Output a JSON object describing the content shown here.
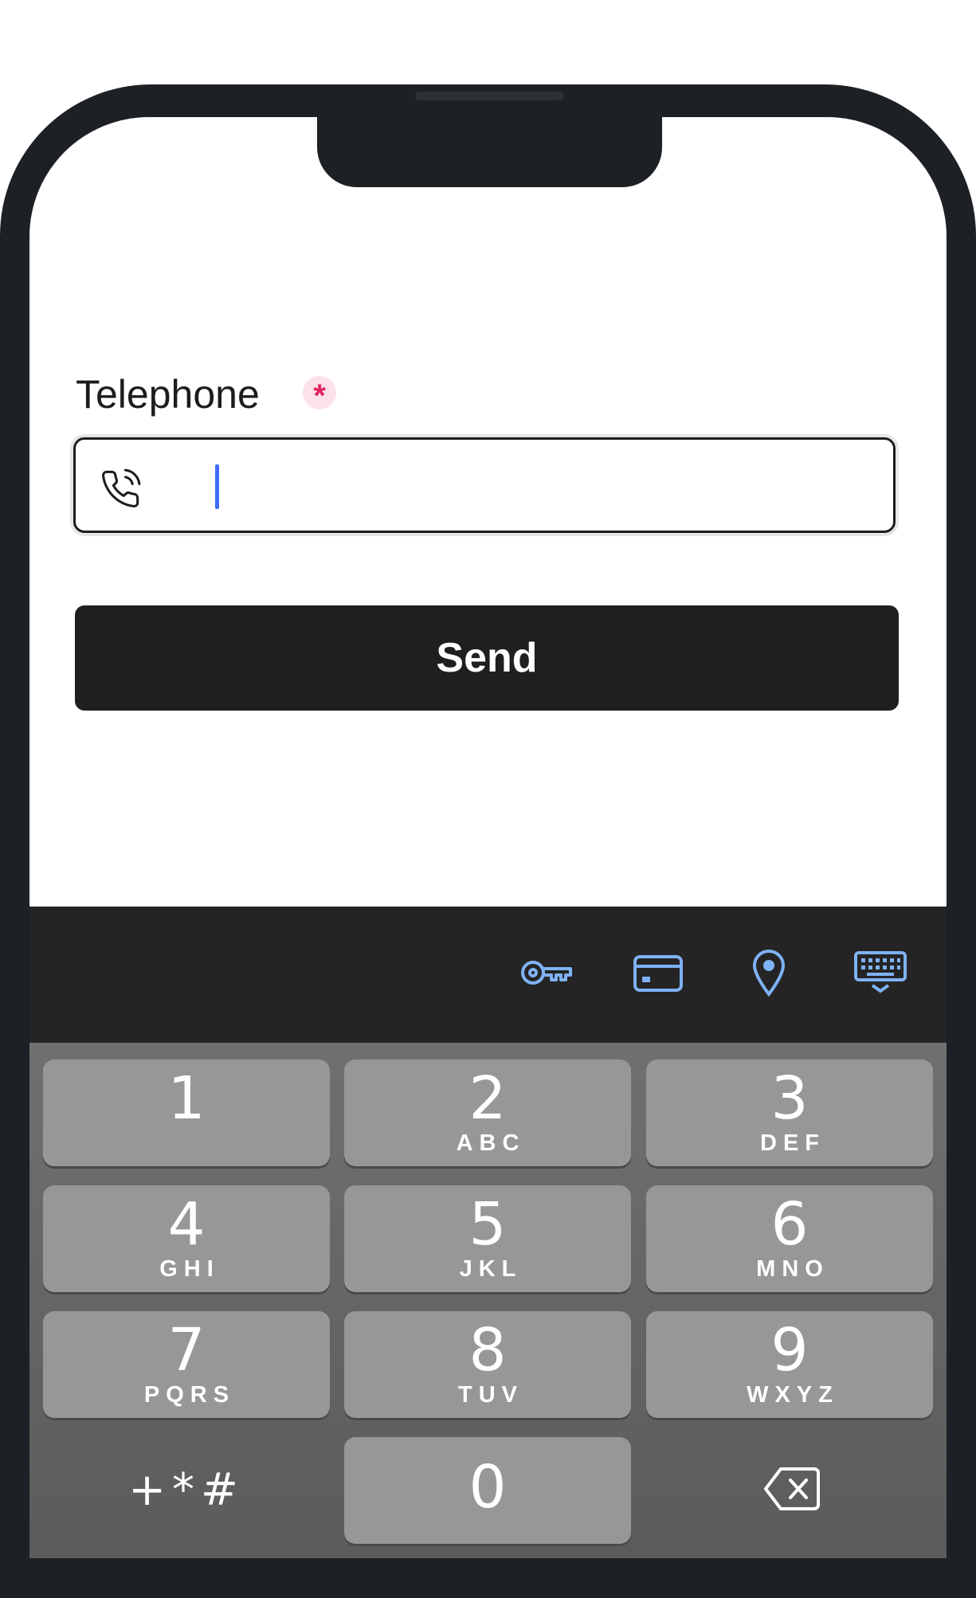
{
  "form": {
    "label": "Telephone",
    "required_marker": "*",
    "phone_value": "",
    "send_label": "Send"
  },
  "accessory_bar": {
    "icons": [
      "key-icon",
      "credit-card-icon",
      "location-pin-icon",
      "keyboard-dismiss-icon"
    ],
    "accent_color": "#7fb2f5"
  },
  "keypad": {
    "keys": [
      {
        "digit": "1",
        "letters": ""
      },
      {
        "digit": "2",
        "letters": "ABC"
      },
      {
        "digit": "3",
        "letters": "DEF"
      },
      {
        "digit": "4",
        "letters": "GHI"
      },
      {
        "digit": "5",
        "letters": "JKL"
      },
      {
        "digit": "6",
        "letters": "MNO"
      },
      {
        "digit": "7",
        "letters": "PQRS"
      },
      {
        "digit": "8",
        "letters": "TUV"
      },
      {
        "digit": "9",
        "letters": "WXYZ"
      }
    ],
    "zero": "0",
    "symbols": "+*#"
  },
  "colors": {
    "frame": "#1d2024",
    "button": "#1f1f1f",
    "caret": "#3d6dfc",
    "required": "#e0245e"
  }
}
